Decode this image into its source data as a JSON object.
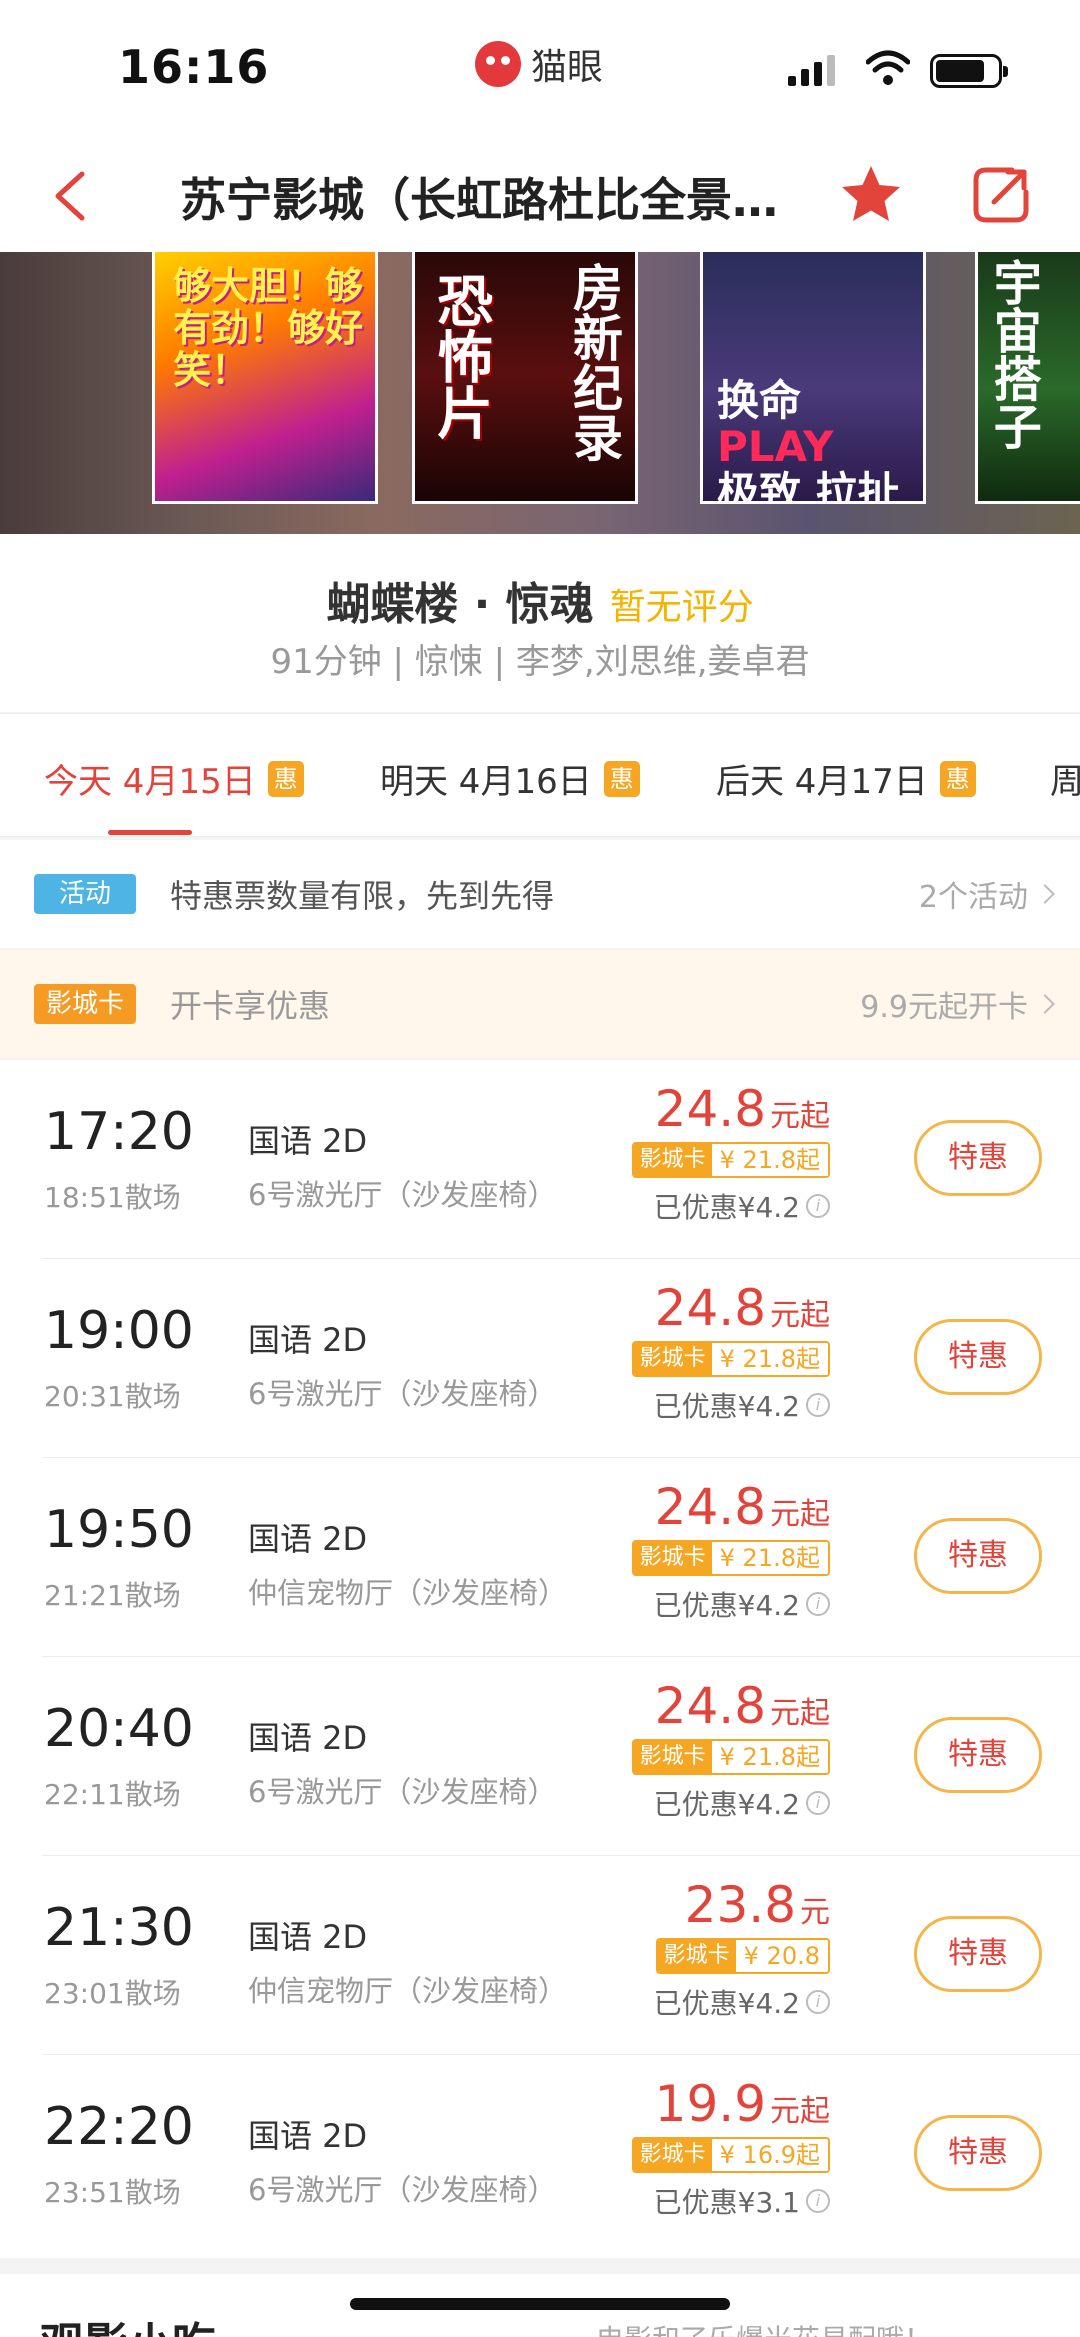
{
  "status": {
    "time": "16:16",
    "brand": "猫眼"
  },
  "nav": {
    "title": "苏宁影城（长虹路杜比全景..."
  },
  "posters": [
    {
      "text": "够大胆！够有劲！够好笑！"
    },
    {
      "text": "恐怖片",
      "text2": "房新纪录"
    },
    {
      "text_a": "换命",
      "text_b": "PLAY",
      "text_c": "极致",
      "text_d": "拉扯"
    },
    {
      "text": "宇宙搭子"
    }
  ],
  "movie": {
    "title": "蝴蝶楼 · 惊魂",
    "score": "暂无评分",
    "meta": "91分钟 | 惊悚 | 李梦,刘思维,姜卓君"
  },
  "dates": [
    {
      "label": "今天 4月15日",
      "badge": "惠",
      "active": true
    },
    {
      "label": "明天 4月16日",
      "badge": "惠"
    },
    {
      "label": "后天 4月17日",
      "badge": "惠"
    },
    {
      "label": "周"
    }
  ],
  "promos": {
    "activity": {
      "tag": "活动",
      "text": "特惠票数量有限，先到先得",
      "right": "2个活动"
    },
    "card": {
      "tag": "影城卡",
      "text": "开卡享优惠",
      "right": "9.9元起开卡"
    }
  },
  "shows": [
    {
      "start": "17:20",
      "end": "18:51散场",
      "lang": "国语 2D",
      "hall": "6号激光厅（沙发座椅）",
      "price": "24.8",
      "unit": "元起",
      "card_tag": "影城卡",
      "card_price": "¥ 21.8起",
      "discount": "已优惠¥4.2",
      "button": "特惠"
    },
    {
      "start": "19:00",
      "end": "20:31散场",
      "lang": "国语 2D",
      "hall": "6号激光厅（沙发座椅）",
      "price": "24.8",
      "unit": "元起",
      "card_tag": "影城卡",
      "card_price": "¥ 21.8起",
      "discount": "已优惠¥4.2",
      "button": "特惠"
    },
    {
      "start": "19:50",
      "end": "21:21散场",
      "lang": "国语 2D",
      "hall": "仲信宠物厅（沙发座椅）",
      "price": "24.8",
      "unit": "元起",
      "card_tag": "影城卡",
      "card_price": "¥ 21.8起",
      "discount": "已优惠¥4.2",
      "button": "特惠"
    },
    {
      "start": "20:40",
      "end": "22:11散场",
      "lang": "国语 2D",
      "hall": "6号激光厅（沙发座椅）",
      "price": "24.8",
      "unit": "元起",
      "card_tag": "影城卡",
      "card_price": "¥ 21.8起",
      "discount": "已优惠¥4.2",
      "button": "特惠"
    },
    {
      "start": "21:30",
      "end": "23:01散场",
      "lang": "国语 2D",
      "hall": "仲信宠物厅（沙发座椅）",
      "price": "23.8",
      "unit": "元",
      "card_tag": "影城卡",
      "card_price": "¥ 20.8",
      "discount": "已优惠¥4.2",
      "button": "特惠"
    },
    {
      "start": "22:20",
      "end": "23:51散场",
      "lang": "国语 2D",
      "hall": "6号激光厅（沙发座椅）",
      "price": "19.9",
      "unit": "元起",
      "card_tag": "影城卡",
      "card_price": "¥ 16.9起",
      "discount": "已优惠¥3.1",
      "button": "特惠"
    }
  ],
  "bottom": {
    "title": "观影小吃",
    "right": "电影和了乐爆米花易配哦！"
  },
  "colors": {
    "accent": "#e2433a",
    "orange": "#f5a623",
    "score": "#f5b400",
    "activity_tag": "#4eb4e4"
  },
  "icons": [
    "back-chevron-icon",
    "favorite-star-icon",
    "share-icon",
    "signal-icon",
    "wifi-icon",
    "battery-icon",
    "info-icon",
    "chevron-right-icon"
  ]
}
